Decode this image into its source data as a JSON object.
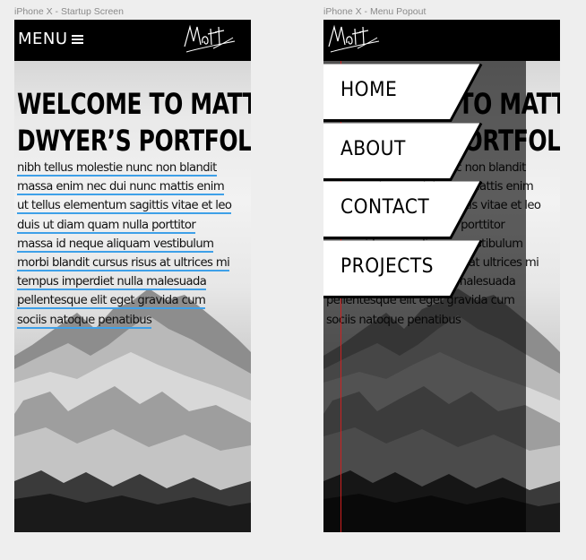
{
  "artboards": [
    {
      "label": "iPhone X - Startup Screen"
    },
    {
      "label": "iPhone X - Menu Popout"
    }
  ],
  "header": {
    "menu_label": "MENU",
    "menu_icon": "hamburger-icon",
    "signature_icon": "matt-signature-logo",
    "signature_text": "Matt"
  },
  "hero": {
    "title_line1": "WELCOME TO MATT",
    "title_line2": "DWYER’S PORTFOLIO",
    "body_lines": [
      "nibh tellus molestie nunc non blandit",
      "massa enim nec dui nunc mattis enim",
      "ut tellus elementum sagittis vitae et leo",
      "duis ut diam quam nulla porttitor",
      "massa id neque aliquam vestibulum",
      "morbi blandit cursus risus at ultrices mi",
      "tempus imperdiet nulla malesuada",
      "pellentesque elit eget gravida cum",
      "sociis natoque penatibus"
    ]
  },
  "menu_popout": {
    "items": [
      {
        "label": "HOME"
      },
      {
        "label": "ABOUT"
      },
      {
        "label": "CONTACT"
      },
      {
        "label": "PROJECTS"
      }
    ]
  },
  "colors": {
    "underline": "#3ea0e8",
    "header_bg": "#000000",
    "guide": "#d02020"
  }
}
